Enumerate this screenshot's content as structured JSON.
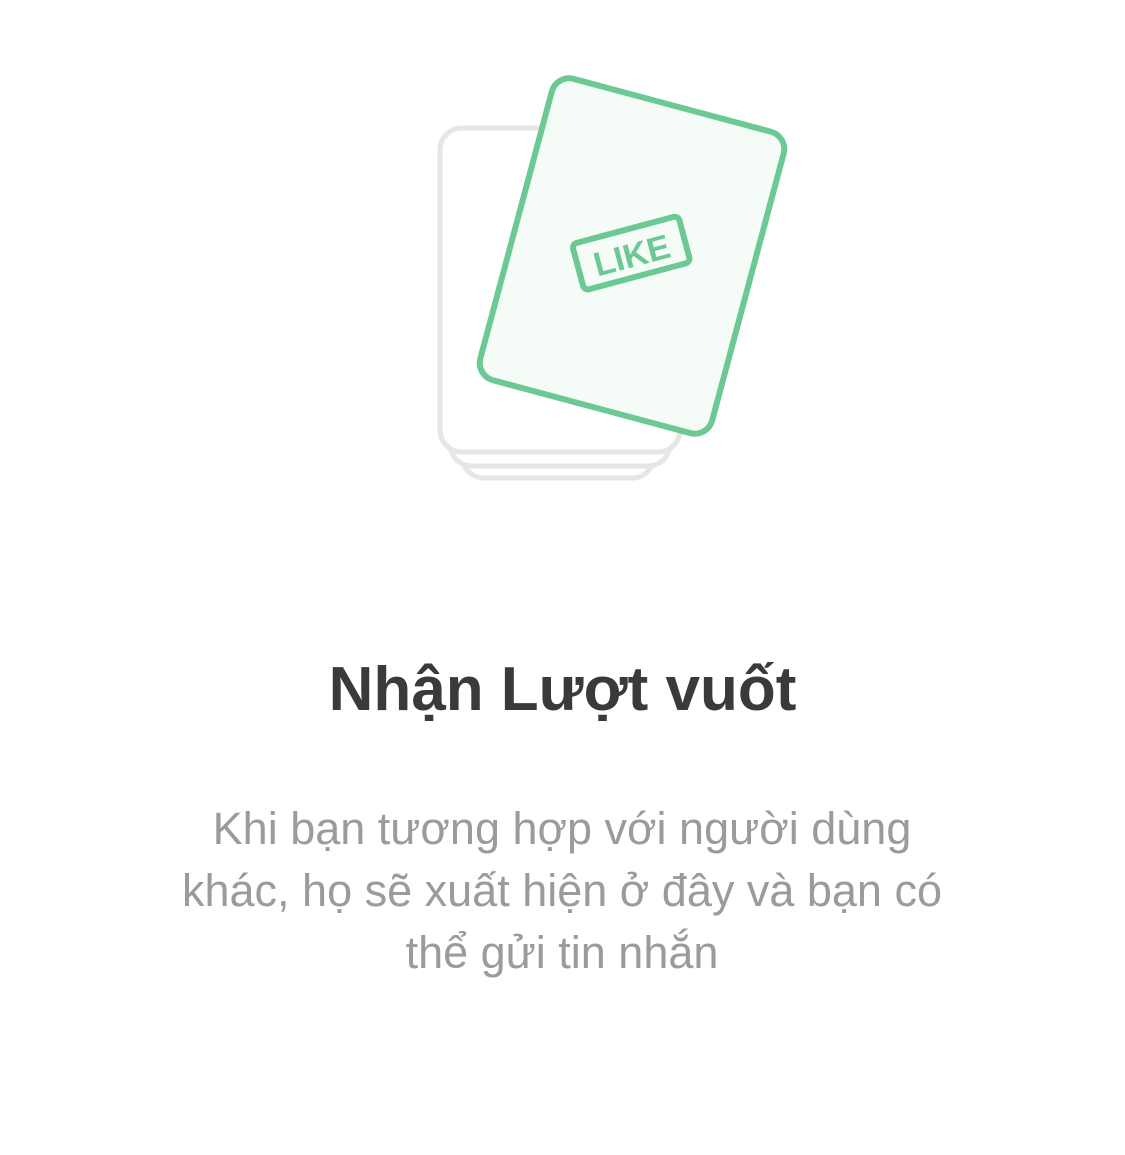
{
  "empty_state": {
    "illustration": {
      "icon": "like-cards-icon",
      "stamp_label": "LIKE",
      "accent_color": "#6cc993",
      "card_fill_color": "#f5fcf8",
      "stack_color": "#e6e6e6"
    },
    "title": "Nhận Lượt vuốt",
    "description": "Khi bạn tương hợp với người dùng khác, họ sẽ xuất hiện ở đây và bạn có thể gửi tin nhắn"
  }
}
